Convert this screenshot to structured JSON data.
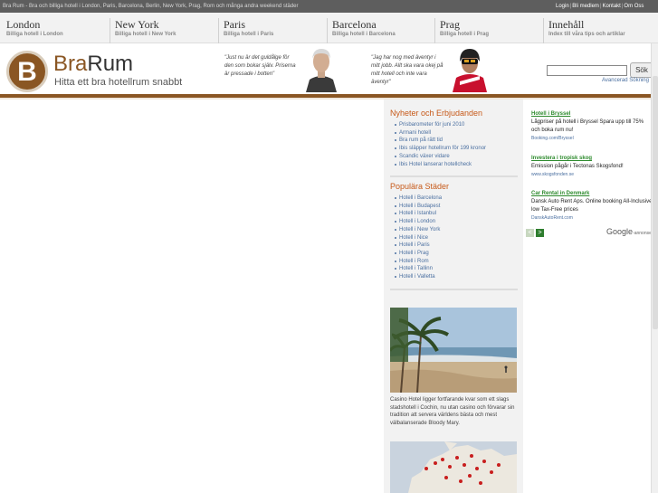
{
  "topbar": {
    "tagline": "Bra Rum - Bra och billiga hotell i London, Paris, Barcelona, Berlin, New York, Prag, Rom och många andra weekend städer",
    "links": [
      "Login",
      "Bli medlem",
      "Kontakt",
      "Om Oss"
    ]
  },
  "cities": [
    {
      "name": "London",
      "sub": "Billiga hotell i London"
    },
    {
      "name": "New York",
      "sub": "Billiga hotell i New York"
    },
    {
      "name": "Paris",
      "sub": "Billiga hotell i Paris"
    },
    {
      "name": "Barcelona",
      "sub": "Billiga hotell i Barcelona"
    },
    {
      "name": "Prag",
      "sub": "Billiga hotell i Prag"
    },
    {
      "name": "Innehåll",
      "sub": "Index till våra tips och artiklar"
    }
  ],
  "header": {
    "logo_letter": "B",
    "brand_a": "Bra",
    "brand_b": "Rum",
    "slogan": "Hitta ett bra hotellrum snabbt",
    "quote1": "\"Just nu är det guldålge för den som bokar själv. Priserna är pressade i botten\"",
    "quote2": "\"Jag har nog med äventyr i mitt jobb. Allt ska vara okej på mitt hotell och inte vara äventyr\""
  },
  "search": {
    "button": "Sök",
    "advanced": "Avancerad Sökning"
  },
  "news": {
    "title": "Nyheter och Erbjudanden",
    "items": [
      "Prisbarometer för juni 2010",
      "Armani hotell",
      "Bra rum på rätt tid",
      "Ibis släpper hotellrum för 199 kronor",
      "Scandic växer vidare",
      "Ibis Hotel lanserar hotellcheck"
    ]
  },
  "popular": {
    "title": "Populära Städer",
    "items": [
      "Hotell i Barcelona",
      "Hotell i Budapest",
      "Hotell i Istanbul",
      "Hotell i London",
      "Hotell i New York",
      "Hotell i Nice",
      "Hotell i Paris",
      "Hotell i Prag",
      "Hotell i Rom",
      "Hotell i Tallinn",
      "Hotell i Valletta"
    ]
  },
  "feature": {
    "caption": "Casino Hotel ligger fortfarande kvar som ett slags stadshotell i Cochin, nu utan casino och förvarar sin tradition att servera världens bästa och mest välbalanserade Bloody Mary."
  },
  "ads": [
    {
      "title": "Hotell i Bryssel",
      "text": "Lågpriser på hotell i Bryssel Spara upp till 75% och boka rum nu!",
      "url": "Booking.com/Bryssel"
    },
    {
      "title": "Investera i tropisk skog",
      "text": "Emission pågår i Tectonas Skogsfond!",
      "url": "www.skogsfonden.se"
    },
    {
      "title": "Car Rental in Denmark",
      "text": "Dansk Auto Rent Aps. Online booking All-Inclusive low Tax-Free prices",
      "url": "DanskAutoRent.com"
    }
  ],
  "ads_footer": {
    "prev": "<",
    "next": ">",
    "brand": "Google",
    "label": "-annonser"
  },
  "colors": {
    "brand_brown": "#8a5623",
    "accent_orange": "#c75a1a",
    "link_blue": "#4a6fa0",
    "ad_green": "#2e8b2e"
  }
}
